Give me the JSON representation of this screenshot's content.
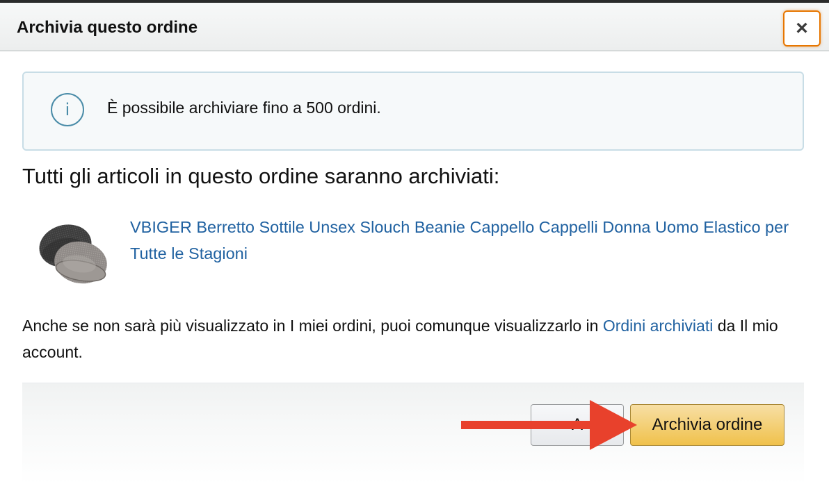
{
  "modal": {
    "title": "Archivia questo ordine",
    "close_label": "×"
  },
  "info": {
    "icon": "info-icon",
    "icon_glyph": "i",
    "text": "È possibile archiviare fino a 500 ordini."
  },
  "heading": "Tutti gli articoli in questo ordine saranno archiviati:",
  "product": {
    "title": "VBIGER Berretto Sottile Unsex Slouch Beanie Cappello Cappelli Donna Uomo Elastico per Tutte le Stagioni",
    "image_icon": "beanie-hat-image"
  },
  "note": {
    "prefix": "Anche se non sarà più visualizzato in I miei ordini, puoi comunque visualizzarlo in ",
    "link": "Ordini archiviati",
    "suffix": " da Il mio account."
  },
  "buttons": {
    "cancel_label": "A",
    "primary_label": "Archivia ordine"
  },
  "colors": {
    "link": "#2162a1",
    "primary_button": "#f0c14b",
    "focus_ring": "#e77600",
    "info_icon": "#4a8ca8",
    "annotation_arrow": "#e8412c"
  }
}
